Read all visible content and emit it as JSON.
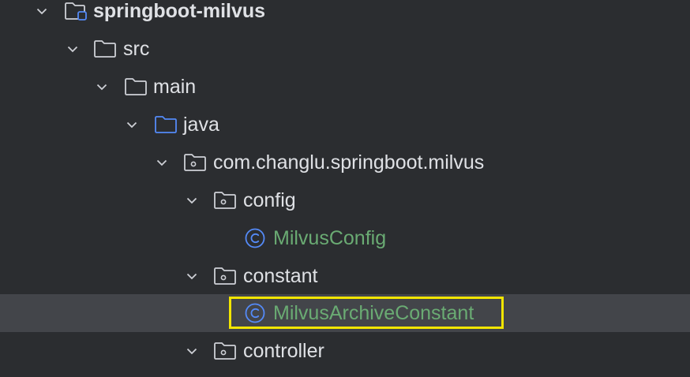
{
  "project_tree": {
    "root": "springboot-milvus",
    "src": "src",
    "main": "main",
    "java": "java",
    "package": "com.changlu.springboot.milvus",
    "config_pkg": "config",
    "milvus_config": "MilvusConfig",
    "constant_pkg": "constant",
    "archive_constant": "MilvusArchiveConstant",
    "controller_pkg": "controller"
  },
  "icons": {
    "folder": "folder-icon",
    "module": "module-folder-icon",
    "source_root": "source-root-icon",
    "package": "package-icon",
    "class": "class-icon",
    "expand": "chevron-down-icon"
  },
  "colors": {
    "background": "#2b2d30",
    "selected_row": "#43454a",
    "text": "#dfe1e5",
    "class_name": "#6aab73",
    "class_icon": "#548af7",
    "source_root_folder": "#548af7",
    "highlight_box": "#f2e500"
  }
}
